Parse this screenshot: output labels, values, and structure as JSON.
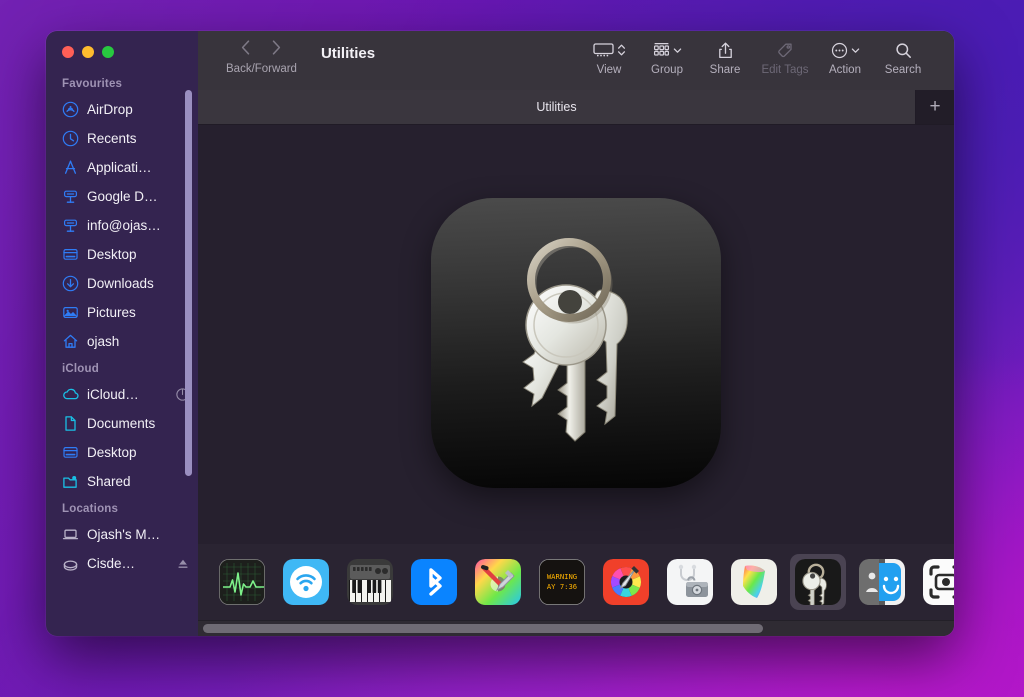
{
  "window": {
    "title": "Utilities",
    "traffic_lights": [
      "close",
      "minimize",
      "zoom"
    ]
  },
  "toolbar": {
    "nav_caption": "Back/Forward",
    "back_icon": "chevron-left-icon",
    "forward_icon": "chevron-right-icon",
    "buttons": [
      {
        "label": "View",
        "icon": "gallery-view-icon",
        "has_chevron": true,
        "disabled": false
      },
      {
        "label": "Group",
        "icon": "group-by-icon",
        "has_chevron": true,
        "disabled": false
      },
      {
        "label": "Share",
        "icon": "share-icon",
        "has_chevron": false,
        "disabled": false
      },
      {
        "label": "Edit Tags",
        "icon": "tag-icon",
        "has_chevron": false,
        "disabled": true
      },
      {
        "label": "Action",
        "icon": "ellipsis-circle-icon",
        "has_chevron": true,
        "disabled": false
      },
      {
        "label": "Search",
        "icon": "search-icon",
        "has_chevron": false,
        "disabled": false
      }
    ]
  },
  "tabbar": {
    "active_tab": "Utilities",
    "add_label": "+"
  },
  "sidebar": {
    "sections": [
      {
        "title": "Favourites",
        "items": [
          {
            "label": "AirDrop",
            "icon": "airdrop-icon"
          },
          {
            "label": "Recents",
            "icon": "clock-icon"
          },
          {
            "label": "Applicati…",
            "icon": "applications-icon"
          },
          {
            "label": "Google D…",
            "icon": "server-icon"
          },
          {
            "label": "info@ojas…",
            "icon": "server-icon"
          },
          {
            "label": "Desktop",
            "icon": "desktop-icon"
          },
          {
            "label": "Downloads",
            "icon": "downloads-icon"
          },
          {
            "label": "Pictures",
            "icon": "pictures-icon"
          },
          {
            "label": "ojash",
            "icon": "home-icon"
          }
        ]
      },
      {
        "title": "iCloud",
        "items": [
          {
            "label": "iCloud…",
            "icon": "icloud-icon",
            "trailing_icon": "progress-circle-icon"
          },
          {
            "label": "Documents",
            "icon": "document-icon"
          },
          {
            "label": "Desktop",
            "icon": "desktop-icon"
          },
          {
            "label": "Shared",
            "icon": "shared-folder-icon"
          }
        ]
      },
      {
        "title": "Locations",
        "items": [
          {
            "label": "Ojash's M…",
            "icon": "laptop-icon"
          },
          {
            "label": "Cisde…",
            "icon": "external-disk-icon",
            "trailing_icon": "eject-icon"
          }
        ]
      }
    ]
  },
  "preview": {
    "app_name": "Keychain Access",
    "icon": "keychain-access-icon"
  },
  "filmstrip": {
    "selected_index": 9,
    "items": [
      {
        "name": "Activity Monitor",
        "icon": "activity-monitor-icon"
      },
      {
        "name": "AirPort Utility",
        "icon": "airport-utility-icon"
      },
      {
        "name": "Audio MIDI Setup",
        "icon": "audio-midi-setup-icon"
      },
      {
        "name": "Bluetooth Screen Sharing",
        "icon": "bluetooth-icon"
      },
      {
        "name": "ColorSync Utility",
        "icon": "colorsync-utility-icon"
      },
      {
        "name": "Console",
        "icon": "console-icon",
        "badge_text": "WARNING 7:36"
      },
      {
        "name": "Digital Color Meter",
        "icon": "digital-color-meter-icon"
      },
      {
        "name": "Disk Utility",
        "icon": "disk-utility-icon"
      },
      {
        "name": "Grapher",
        "icon": "grapher-icon"
      },
      {
        "name": "Keychain Access",
        "icon": "keychain-access-icon"
      },
      {
        "name": "Migration Assistant",
        "icon": "migration-assistant-icon"
      },
      {
        "name": "Screenshot",
        "icon": "screenshot-icon"
      }
    ]
  },
  "scrollbars": {
    "sidebar_vertical_percent": 85,
    "filmstrip_horizontal_percent": 75
  },
  "colors": {
    "sidebar_bg": "#342450",
    "toolbar_bg": "#38343c",
    "content_bg": "#26202e",
    "accent_blue": "#2f7cf6",
    "wallpaper_purple": "#6a14ae",
    "wallpaper_magenta": "#b316c8"
  }
}
